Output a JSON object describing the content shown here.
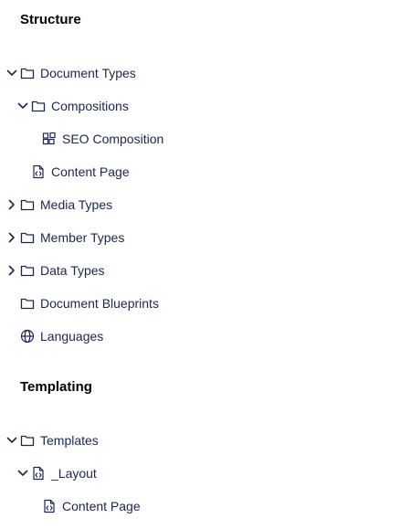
{
  "sections": {
    "structure": {
      "heading": "Structure",
      "items": {
        "document_types": "Document Types",
        "compositions": "Compositions",
        "seo_composition": "SEO Composition",
        "content_page": "Content Page",
        "media_types": "Media Types",
        "member_types": "Member Types",
        "data_types": "Data Types",
        "document_blueprints": "Document Blueprints",
        "languages": "Languages"
      }
    },
    "templating": {
      "heading": "Templating",
      "items": {
        "templates": "Templates",
        "layout": "_Layout",
        "content_page": "Content Page"
      }
    }
  },
  "icons": {
    "expanded": "chevron-down-icon",
    "collapsed": "chevron-right-icon",
    "folder": "folder-icon",
    "composition": "blocks-icon",
    "document": "code-document-icon",
    "globe": "globe-icon"
  },
  "colors": {
    "text": "#1b264f",
    "heading": "#000000",
    "background": "#ffffff"
  }
}
